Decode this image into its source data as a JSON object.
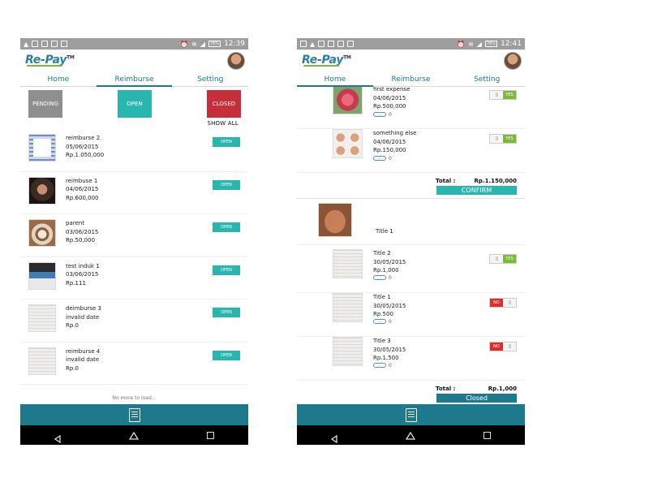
{
  "phones": [
    {
      "status": {
        "time": "12:39",
        "battery": "76%"
      },
      "logo": {
        "text": "Re-Pay",
        "tm": "TM"
      },
      "tabs": [
        "Home",
        "Reimburse",
        "Setting"
      ],
      "active_tab": "Reimburse",
      "filters": {
        "pending": "PENDING",
        "open": "OPEN",
        "closed": "CLOSED"
      },
      "show_all": "SHOW ALL",
      "rows": [
        {
          "title": "reimburse 2",
          "date": "05/06/2015",
          "amount": "Rp.1.050,000",
          "badge": "OPEN",
          "thumb": "screenshot"
        },
        {
          "title": "reimbuse 1",
          "date": "04/06/2015",
          "amount": "Rp.600,000",
          "badge": "OPEN",
          "thumb": "portrait"
        },
        {
          "title": "parent",
          "date": "03/06/2015",
          "amount": "Rp.50,000",
          "badge": "OPEN",
          "thumb": "coffee-cup"
        },
        {
          "title": "test induk 1",
          "date": "03/06/2015",
          "amount": "Rp.111",
          "badge": "OPEN",
          "thumb": "laptop"
        },
        {
          "title": "deimburse 3",
          "date": "invalid date",
          "amount": "Rp.0",
          "badge": "OPEN",
          "thumb": "receipt"
        },
        {
          "title": "reimburse 4",
          "date": "invalid date",
          "amount": "Rp.0",
          "badge": "OPEN",
          "thumb": "receipt"
        }
      ],
      "no_more": "No more to load..."
    },
    {
      "status": {
        "time": "12:41",
        "battery": "76%"
      },
      "logo": {
        "text": "Re-Pay",
        "tm": "TM"
      },
      "tabs": [
        "Home",
        "Reimburse",
        "Setting"
      ],
      "active_tab": "Home",
      "group1": {
        "rows": [
          {
            "title": "first expense",
            "date": "04/06/2015",
            "amount": "Rp.500,000",
            "toggle": "YES",
            "chip": "...",
            "chip_count": "0",
            "thumb": "rose"
          },
          {
            "title": "something else",
            "date": "04/06/2015",
            "amount": "Rp.150,000",
            "toggle": "YES",
            "chip": "...",
            "chip_count": "0",
            "thumb": "faces"
          }
        ],
        "total_label": "Total :",
        "total_value": "Rp.1.150,000",
        "button": "CONFIRM"
      },
      "group2": {
        "title": "Title 1",
        "thumb": "smiling-face",
        "rows": [
          {
            "title": "Title 2",
            "date": "30/05/2015",
            "amount": "Rp.1,000",
            "toggle": "YES",
            "chip": "...",
            "chip_count": "0",
            "thumb": "receipt"
          },
          {
            "title": "Title 1",
            "date": "30/05/2015",
            "amount": "Rp.500",
            "toggle": "NO",
            "chip": "...",
            "chip_count": "0",
            "thumb": "receipt"
          },
          {
            "title": "Title 3",
            "date": "30/05/2015",
            "amount": "Rp.1,500",
            "toggle": "NO",
            "chip": "...",
            "chip_count": "0",
            "thumb": "receipt"
          }
        ],
        "total_label": "Total :",
        "total_value": "Rp.1,000",
        "button": "Closed"
      }
    }
  ],
  "colors": {
    "teal": "#1d7a8c",
    "open": "#29b6ae",
    "closed": "#c62f3a",
    "pending": "#8f8f8f",
    "yes": "#7cb93a",
    "no": "#d9302f"
  },
  "icons": {
    "footer": "document-icon",
    "nav": [
      "back-icon",
      "home-icon",
      "recents-icon"
    ]
  }
}
